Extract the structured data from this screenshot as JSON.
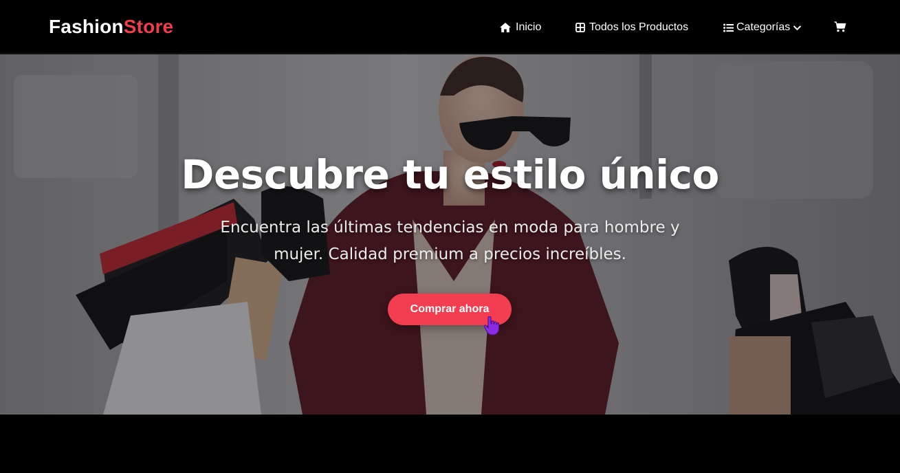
{
  "brand": {
    "part1": "Fashion",
    "part2": "Store",
    "accent_color": "#ef3e4e"
  },
  "nav": {
    "items": [
      {
        "label": "Inicio",
        "icon": "home-icon"
      },
      {
        "label": "Todos los Productos",
        "icon": "grid-icon"
      },
      {
        "label": "Categorías",
        "icon": "list-icon",
        "dropdown": true
      },
      {
        "label": "",
        "icon": "cart-icon"
      }
    ]
  },
  "hero": {
    "title": "Descubre tu estilo único",
    "subtitle": "Encuentra las últimas tendencias en moda para hombre y mujer. Calidad premium a precios increíbles.",
    "cta_label": "Comprar ahora",
    "cta_color": "#f23e50"
  },
  "cursor": {
    "type": "hand-pointer",
    "color": "#8a2be2"
  }
}
